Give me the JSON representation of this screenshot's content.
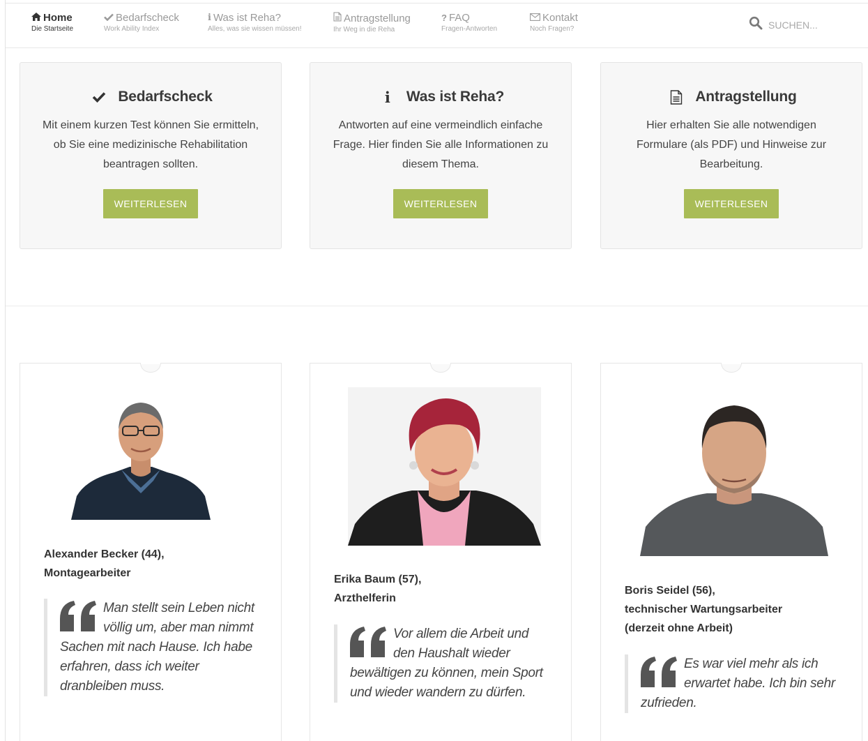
{
  "nav": {
    "items": [
      {
        "label": "Home",
        "sub": "Die Startseite",
        "icon": "home-icon"
      },
      {
        "label": "Bedarfscheck",
        "sub": "Work Ability Index",
        "icon": "check-icon"
      },
      {
        "label": "Was ist Reha?",
        "sub": "Alles, was sie wissen müssen!",
        "icon": "info-icon"
      },
      {
        "label": "Antragstellung",
        "sub": "Ihr Weg in die Reha",
        "icon": "document-icon"
      },
      {
        "label": "FAQ",
        "sub": "Fragen-Antworten",
        "icon": "question-icon"
      },
      {
        "label": "Kontakt",
        "sub": "Noch Fragen?",
        "icon": "envelope-icon"
      }
    ],
    "search_placeholder": "SUCHEN..."
  },
  "features": [
    {
      "title": "Bedarfscheck",
      "icon": "check-icon",
      "text": "Mit einem kurzen Test können Sie ermitteln, ob Sie eine medizinische Rehabilitation beantragen sollten.",
      "button": "WEITERLESEN"
    },
    {
      "title": "Was ist Reha?",
      "icon": "info-icon",
      "text": "Antworten auf eine vermeindlich einfache Frage. Hier finden Sie alle Informationen zu diesem Thema.",
      "button": "WEITERLESEN"
    },
    {
      "title": "Antragstellung",
      "icon": "document-icon",
      "text": "Hier erhalten Sie alle notwendigen Formulare (als PDF) und Hinweise zur Bearbeitung.",
      "button": "WEITERLESEN"
    }
  ],
  "testimonials": [
    {
      "name": "Alexander Becker (44),",
      "role": "Montagearbeiter",
      "role2": "",
      "quote": "Man stellt sein Leben nicht völlig um, aber man nimmt Sachen mit nach Hause. Ich habe erfahren, dass ich weiter dranbleiben muss."
    },
    {
      "name": "Erika Baum (57),",
      "role": "Arzthelferin",
      "role2": "",
      "quote": "Vor allem die Arbeit und den Haushalt wieder bewältigen zu können, mein Sport und wieder wandern zu dürfen."
    },
    {
      "name": "Boris Seidel (56),",
      "role": "technischer Wartungsarbeiter",
      "role2": "(derzeit ohne Arbeit)",
      "quote": "Es war viel mehr als ich erwartet habe. Ich bin sehr zufrieden."
    }
  ],
  "colors": {
    "accent": "#a9bc57",
    "text": "#333333",
    "muted": "#9a9a9a"
  }
}
